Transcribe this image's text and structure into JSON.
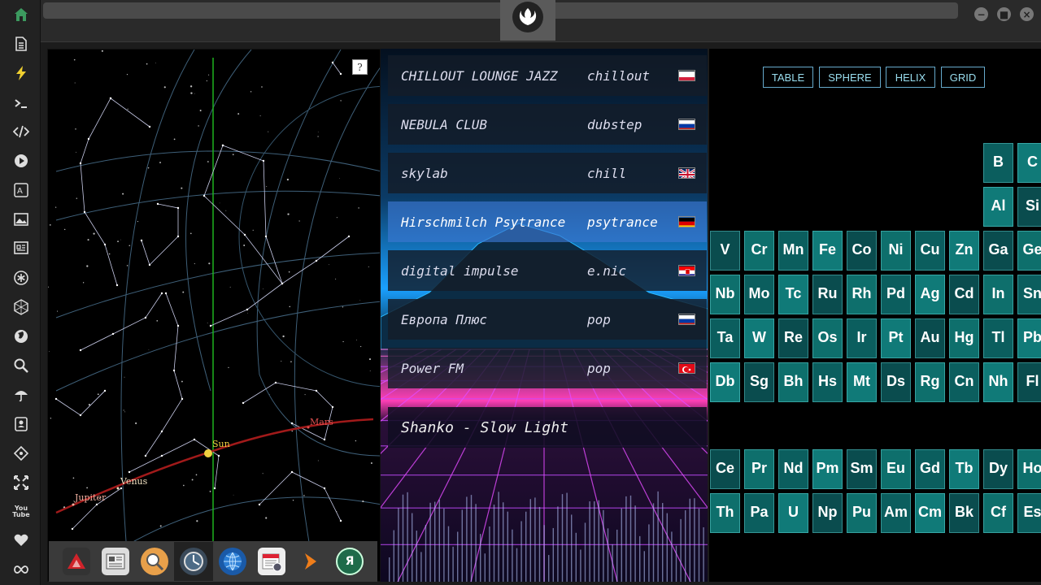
{
  "sidebar": {
    "items": [
      {
        "icon": "home-icon",
        "name": "Home"
      },
      {
        "icon": "document-icon",
        "name": "Documents"
      },
      {
        "icon": "lightning-icon",
        "name": "Activity"
      },
      {
        "icon": "terminal-icon",
        "name": "Terminal"
      },
      {
        "icon": "code-icon",
        "name": "Code"
      },
      {
        "icon": "play-icon",
        "name": "Media"
      },
      {
        "icon": "translate-icon",
        "name": "Translate"
      },
      {
        "icon": "image-icon",
        "name": "Images"
      },
      {
        "icon": "news-icon",
        "name": "News"
      },
      {
        "icon": "asterisk-icon",
        "name": "Settings"
      },
      {
        "icon": "hexagon-icon",
        "name": "Network"
      },
      {
        "icon": "globe-icon",
        "name": "Globe"
      },
      {
        "icon": "search-icon",
        "name": "Search"
      },
      {
        "icon": "umbrella-icon",
        "name": "Weather"
      },
      {
        "icon": "contacts-icon",
        "name": "Contacts"
      },
      {
        "icon": "tag-icon",
        "name": "Tags"
      },
      {
        "icon": "fullscreen-icon",
        "name": "Fullscreen"
      },
      {
        "icon": "youtube-icon",
        "name": "YouTube",
        "label": "You Tube"
      },
      {
        "icon": "heart-icon",
        "name": "Favorites"
      },
      {
        "icon": "infinity-icon",
        "name": "Loop"
      }
    ],
    "active_color": "#3c9a5f"
  },
  "window_controls": [
    "minimize",
    "maximize",
    "close"
  ],
  "sky_map": {
    "help_label": "?",
    "planets": [
      {
        "name": "Mars",
        "color": "#e05050"
      },
      {
        "name": "Sun",
        "color": "#f0d040"
      },
      {
        "name": "Venus",
        "color": "#f0e0c0"
      },
      {
        "name": "Jupiter",
        "color": "#f0b0a0"
      }
    ]
  },
  "dock": {
    "items": [
      {
        "icon": "red-triangle-app-icon",
        "label": ""
      },
      {
        "icon": "news-reader-icon",
        "label": ""
      },
      {
        "icon": "magnifier-app-icon",
        "label": ""
      },
      {
        "icon": "clock-app-icon",
        "label": "",
        "active": true
      },
      {
        "icon": "globe-app-icon",
        "label": ""
      },
      {
        "icon": "calendar-app-icon",
        "label": ""
      },
      {
        "icon": "arrow-app-icon",
        "label": ""
      },
      {
        "icon": "yandex-app-icon",
        "label": "Я"
      }
    ]
  },
  "radio": {
    "stations": [
      {
        "name": "CHILLOUT LOUNGE JAZZ",
        "genre": "chillout",
        "flag": "pl"
      },
      {
        "name": "NEBULA CLUB",
        "genre": "dubstep",
        "flag": "ru"
      },
      {
        "name": "skylab",
        "genre": "chill",
        "flag": "gb"
      },
      {
        "name": "Hirschmilch Psytrance",
        "genre": "psytrance",
        "flag": "de",
        "active": true
      },
      {
        "name": "digital impulse",
        "genre": "e.nic",
        "flag": "hr"
      },
      {
        "name": "Европа Плюс",
        "genre": "pop",
        "flag": "ru"
      },
      {
        "name": "Power FM",
        "genre": "pop",
        "flag": "tr"
      }
    ],
    "now_playing": "Shanko - Slow Light"
  },
  "periodic": {
    "buttons": [
      "TABLE",
      "SPHERE",
      "HELIX",
      "GRID"
    ],
    "rows": [
      {
        "cells": [
          {
            "s": "B"
          },
          {
            "s": "C"
          }
        ],
        "start": 8,
        "row": 0
      },
      {
        "cells": [
          {
            "s": "Al"
          },
          {
            "s": "Si"
          }
        ],
        "start": 8,
        "row": 1
      },
      {
        "cells": [
          {
            "s": "V"
          },
          {
            "s": "Cr"
          },
          {
            "s": "Mn"
          },
          {
            "s": "Fe"
          },
          {
            "s": "Co"
          },
          {
            "s": "Ni"
          },
          {
            "s": "Cu"
          },
          {
            "s": "Zn"
          },
          {
            "s": "Ga"
          },
          {
            "s": "Ge"
          }
        ],
        "start": 0,
        "row": 2
      },
      {
        "cells": [
          {
            "s": "Nb"
          },
          {
            "s": "Mo"
          },
          {
            "s": "Tc"
          },
          {
            "s": "Ru"
          },
          {
            "s": "Rh"
          },
          {
            "s": "Pd"
          },
          {
            "s": "Ag"
          },
          {
            "s": "Cd"
          },
          {
            "s": "In"
          },
          {
            "s": "Sn"
          }
        ],
        "start": 0,
        "row": 3
      },
      {
        "cells": [
          {
            "s": "Ta"
          },
          {
            "s": "W"
          },
          {
            "s": "Re"
          },
          {
            "s": "Os"
          },
          {
            "s": "Ir"
          },
          {
            "s": "Pt"
          },
          {
            "s": "Au"
          },
          {
            "s": "Hg"
          },
          {
            "s": "Tl"
          },
          {
            "s": "Pb"
          }
        ],
        "start": 0,
        "row": 4
      },
      {
        "cells": [
          {
            "s": "Db"
          },
          {
            "s": "Sg"
          },
          {
            "s": "Bh"
          },
          {
            "s": "Hs"
          },
          {
            "s": "Mt"
          },
          {
            "s": "Ds"
          },
          {
            "s": "Rg"
          },
          {
            "s": "Cn"
          },
          {
            "s": "Nh"
          },
          {
            "s": "Fl"
          }
        ],
        "start": 0,
        "row": 5
      },
      {
        "cells": [
          {
            "s": "Ce"
          },
          {
            "s": "Pr"
          },
          {
            "s": "Nd"
          },
          {
            "s": "Pm"
          },
          {
            "s": "Sm"
          },
          {
            "s": "Eu"
          },
          {
            "s": "Gd"
          },
          {
            "s": "Tb"
          },
          {
            "s": "Dy"
          },
          {
            "s": "Ho"
          }
        ],
        "start": 0,
        "row": 7
      },
      {
        "cells": [
          {
            "s": "Th"
          },
          {
            "s": "Pa"
          },
          {
            "s": "U"
          },
          {
            "s": "Np"
          },
          {
            "s": "Pu"
          },
          {
            "s": "Am"
          },
          {
            "s": "Cm"
          },
          {
            "s": "Bk"
          },
          {
            "s": "Cf"
          },
          {
            "s": "Es"
          }
        ],
        "start": 0,
        "row": 8
      }
    ],
    "accent": "#7ff"
  }
}
